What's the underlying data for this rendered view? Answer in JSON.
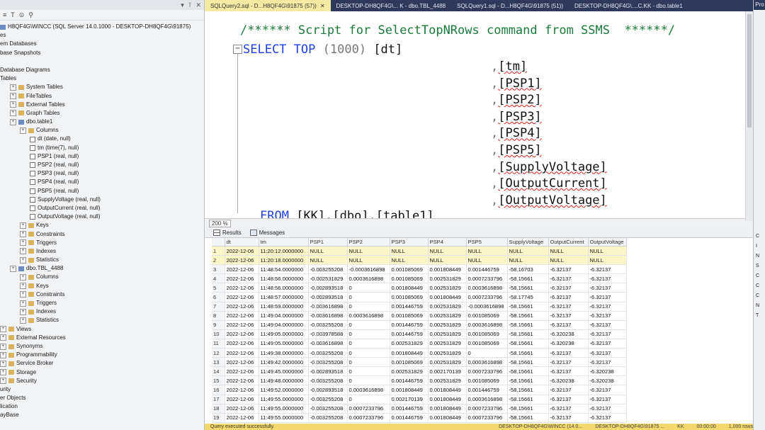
{
  "object_explorer": {
    "toolbar_items": [
      "≡",
      "T",
      "⊙",
      "⚲"
    ],
    "nodes": [
      {
        "text": "H8QF4G\\WINCC (SQL Server 14.0.1000 - DESKTOP-DH8QF4G\\91875)",
        "indent": 0,
        "icon": "server"
      },
      {
        "text": "es",
        "indent": 0,
        "icon": "none"
      },
      {
        "text": "em Databases",
        "indent": 0,
        "icon": "none"
      },
      {
        "text": "base Snapshots",
        "indent": 0,
        "icon": "none"
      },
      {
        "text": "",
        "indent": 0,
        "icon": "none"
      },
      {
        "text": "Database Diagrams",
        "indent": 0,
        "icon": "none"
      },
      {
        "text": "Tables",
        "indent": 0,
        "icon": "none"
      },
      {
        "text": "System Tables",
        "indent": 1,
        "icon": "folder"
      },
      {
        "text": "FileTables",
        "indent": 1,
        "icon": "folder"
      },
      {
        "text": "External Tables",
        "indent": 1,
        "icon": "folder"
      },
      {
        "text": "Graph Tables",
        "indent": 1,
        "icon": "folder"
      },
      {
        "text": "dbo.table1",
        "indent": 1,
        "icon": "table"
      },
      {
        "text": "Columns",
        "indent": 2,
        "icon": "folder"
      },
      {
        "text": "dt (date, null)",
        "indent": 3,
        "icon": "column"
      },
      {
        "text": "tm (time(7), null)",
        "indent": 3,
        "icon": "column"
      },
      {
        "text": "PSP1 (real, null)",
        "indent": 3,
        "icon": "column"
      },
      {
        "text": "PSP2 (real, null)",
        "indent": 3,
        "icon": "column"
      },
      {
        "text": "PSP3 (real, null)",
        "indent": 3,
        "icon": "column"
      },
      {
        "text": "PSP4 (real, null)",
        "indent": 3,
        "icon": "column"
      },
      {
        "text": "PSP5 (real, null)",
        "indent": 3,
        "icon": "column"
      },
      {
        "text": "SupplyVoltage (real, null)",
        "indent": 3,
        "icon": "column"
      },
      {
        "text": "OutputCurrent (real, null)",
        "indent": 3,
        "icon": "column"
      },
      {
        "text": "OutputVoltage (real, null)",
        "indent": 3,
        "icon": "column"
      },
      {
        "text": "Keys",
        "indent": 2,
        "icon": "folder"
      },
      {
        "text": "Constraints",
        "indent": 2,
        "icon": "folder"
      },
      {
        "text": "Triggers",
        "indent": 2,
        "icon": "folder"
      },
      {
        "text": "Indexes",
        "indent": 2,
        "icon": "folder"
      },
      {
        "text": "Statistics",
        "indent": 2,
        "icon": "folder"
      },
      {
        "text": "dbo.TBL_4488",
        "indent": 1,
        "icon": "table"
      },
      {
        "text": "Columns",
        "indent": 2,
        "icon": "folder"
      },
      {
        "text": "Keys",
        "indent": 2,
        "icon": "folder"
      },
      {
        "text": "Constraints",
        "indent": 2,
        "icon": "folder"
      },
      {
        "text": "Triggers",
        "indent": 2,
        "icon": "folder"
      },
      {
        "text": "Indexes",
        "indent": 2,
        "icon": "folder"
      },
      {
        "text": "Statistics",
        "indent": 2,
        "icon": "folder"
      },
      {
        "text": "Views",
        "indent": 0,
        "icon": "folder"
      },
      {
        "text": "External Resources",
        "indent": 0,
        "icon": "folder"
      },
      {
        "text": "Synonyms",
        "indent": 0,
        "icon": "folder"
      },
      {
        "text": "Programmability",
        "indent": 0,
        "icon": "folder"
      },
      {
        "text": "Service Broker",
        "indent": 0,
        "icon": "folder"
      },
      {
        "text": "Storage",
        "indent": 0,
        "icon": "folder"
      },
      {
        "text": "Security",
        "indent": 0,
        "icon": "folder"
      },
      {
        "text": "urity",
        "indent": 0,
        "icon": "none"
      },
      {
        "text": "er Objects",
        "indent": 0,
        "icon": "none"
      },
      {
        "text": "lication",
        "indent": 0,
        "icon": "none"
      },
      {
        "text": "ayBase",
        "indent": 0,
        "icon": "none"
      }
    ]
  },
  "tabs": [
    {
      "label": "SQLQuery2.sql - D...H8QF4G\\91875 (57))",
      "active": true
    },
    {
      "label": "DESKTOP-DH8QF4G\\... K - dbo.TBL_4488",
      "active": false
    },
    {
      "label": "SQLQuery1.sql - D...H8QF4G\\91875 (51))",
      "active": false
    },
    {
      "label": "DESKTOP-DH8QF4G\\....C.KK - dbo.table1",
      "active": false
    }
  ],
  "sql": {
    "comment": "/****** Script for SelectTopNRows command from SSMS  ******/",
    "select_kw": "SELECT",
    "top_kw": "TOP",
    "top_value": "(1000)",
    "first_col": "[dt]",
    "columns": [
      "[tm]",
      "[PSP1]",
      "[PSP2]",
      "[PSP3]",
      "[PSP4]",
      "[PSP5]",
      "[SupplyVoltage]",
      "[OutputCurrent]",
      "[OutputVoltage]"
    ],
    "from_kw": "FROM",
    "from_target": "[KK].[dbo].[table1]"
  },
  "zoom": "200 %",
  "result_tabs": {
    "results": "Results",
    "messages": "Messages"
  },
  "results": {
    "headers": [
      "",
      "dt",
      "tm",
      "PSP1",
      "PSP2",
      "PSP3",
      "PSP4",
      "PSP5",
      "SupplyVoltage",
      "OutputCurrent",
      "OutputVoltage"
    ],
    "rows": [
      [
        "1",
        "2022-12-06",
        "11:20:12.0000000",
        "NULL",
        "NULL",
        "NULL",
        "NULL",
        "NULL",
        "NULL",
        "NULL",
        "NULL"
      ],
      [
        "2",
        "2022-12-06",
        "11:20:18.0000000",
        "NULL",
        "NULL",
        "NULL",
        "NULL",
        "NULL",
        "NULL",
        "NULL",
        "NULL"
      ],
      [
        "3",
        "2022-12-06",
        "11:48:54.0000000",
        "-0.003255208",
        "-0.0003616898",
        "0.001085069",
        "0.001808449",
        "0.001446759",
        "-58.16703",
        "-6.32137",
        "-6.32137"
      ],
      [
        "4",
        "2022-12-06",
        "11:48:56.0000000",
        "-0.002531829",
        "0.0003616898",
        "0.001085069",
        "0.002531829",
        "0.0007233796",
        "-58.15661",
        "-6.32137",
        "-6.32137"
      ],
      [
        "5",
        "2022-12-06",
        "11:48:56.0000000",
        "-0.002893518",
        "0",
        "0.001808449",
        "0.002531829",
        "0.0003616898",
        "-58.15661",
        "-6.32137",
        "-6.32137"
      ],
      [
        "6",
        "2022-12-06",
        "11:48:57.0000000",
        "-0.002893518",
        "0",
        "0.001085069",
        "0.001808449",
        "0.0007233796",
        "-58.17745",
        "-6.32137",
        "-6.32137"
      ],
      [
        "7",
        "2022-12-06",
        "11:48:59.0000000",
        "-0.003616898",
        "0",
        "0.001446759",
        "0.002531829",
        "-0.0003616898",
        "-58.15661",
        "-6.32137",
        "-6.32137"
      ],
      [
        "8",
        "2022-12-06",
        "11:49:04.0000000",
        "-0.003616898",
        "0.0003616898",
        "0.001085069",
        "0.002531829",
        "0.001085069",
        "-58.15661",
        "-6.32137",
        "-6.32137"
      ],
      [
        "9",
        "2022-12-06",
        "11:49:04.0000000",
        "-0.003255208",
        "0",
        "0.001446759",
        "0.002531829",
        "0.0003616898",
        "-58.15661",
        "-6.32137",
        "-6.32137"
      ],
      [
        "10",
        "2022-12-06",
        "11:49:05.0000000",
        "-0.003978588",
        "0",
        "0.001446759",
        "0.002531829",
        "0.001085069",
        "-58.15661",
        "-6.320238",
        "-6.32137"
      ],
      [
        "11",
        "2022-12-06",
        "11:49:05.0000000",
        "-0.003616898",
        "0",
        "0.002531829",
        "0.002531829",
        "0.001085069",
        "-58.15661",
        "-6.320238",
        "-6.32137"
      ],
      [
        "12",
        "2022-12-06",
        "11:49:38.0000000",
        "-0.003255208",
        "0",
        "0.001808449",
        "0.002531829",
        "0",
        "-58.15661",
        "-6.32137",
        "-6.32137"
      ],
      [
        "13",
        "2022-12-06",
        "11:49:42.0000000",
        "-0.003255208",
        "0",
        "0.001085069",
        "0.002531829",
        "0.0003616898",
        "-58.15661",
        "-6.32137",
        "-6.32137"
      ],
      [
        "14",
        "2022-12-06",
        "11:49:45.0000000",
        "-0.002893518",
        "0",
        "0.002531829",
        "0.002170139",
        "0.0007233796",
        "-58.15661",
        "-6.32137",
        "-6.320238"
      ],
      [
        "15",
        "2022-12-06",
        "11:49:48.0000000",
        "-0.003255208",
        "0",
        "0.001446759",
        "0.002531829",
        "0.001085069",
        "-58.15661",
        "-6.320238",
        "-6.320238"
      ],
      [
        "16",
        "2022-12-06",
        "11:49:52.0000000",
        "-0.002893518",
        "0.0003616898",
        "0.001808449",
        "0.001808449",
        "0.001446759",
        "-58.15661",
        "-6.32137",
        "-6.32137"
      ],
      [
        "17",
        "2022-12-06",
        "11:49:55.0000000",
        "-0.003255208",
        "0",
        "0.002170139",
        "0.001808449",
        "0.0003616898",
        "-58.15661",
        "-6.32137",
        "-6.32137"
      ],
      [
        "18",
        "2022-12-06",
        "11:49:55.0000000",
        "-0.003255208",
        "0.0007233796",
        "0.001446759",
        "0.001808449",
        "0.0007233796",
        "-58.15661",
        "-6.32137",
        "-6.32137"
      ],
      [
        "19",
        "2022-12-06",
        "11:49:55.0000000",
        "-0.003255208",
        "0.0007233796",
        "0.001446759",
        "0.001808449",
        "0.0007233796",
        "-58.15661",
        "-6.32137",
        "-6.32137"
      ]
    ]
  },
  "status": {
    "message": "Query executed successfully.",
    "right": [
      "DESKTOP-DH8QF4G\\WINCC (14.0...",
      "DESKTOP-DH8QF4G\\91875 ...",
      "KK",
      "00:00:00",
      "1,000 rows"
    ]
  },
  "right_panel": {
    "header": "Pro",
    "letters": [
      "C",
      "I",
      "N",
      "S",
      "C",
      "C",
      "C",
      "N",
      "T"
    ]
  }
}
